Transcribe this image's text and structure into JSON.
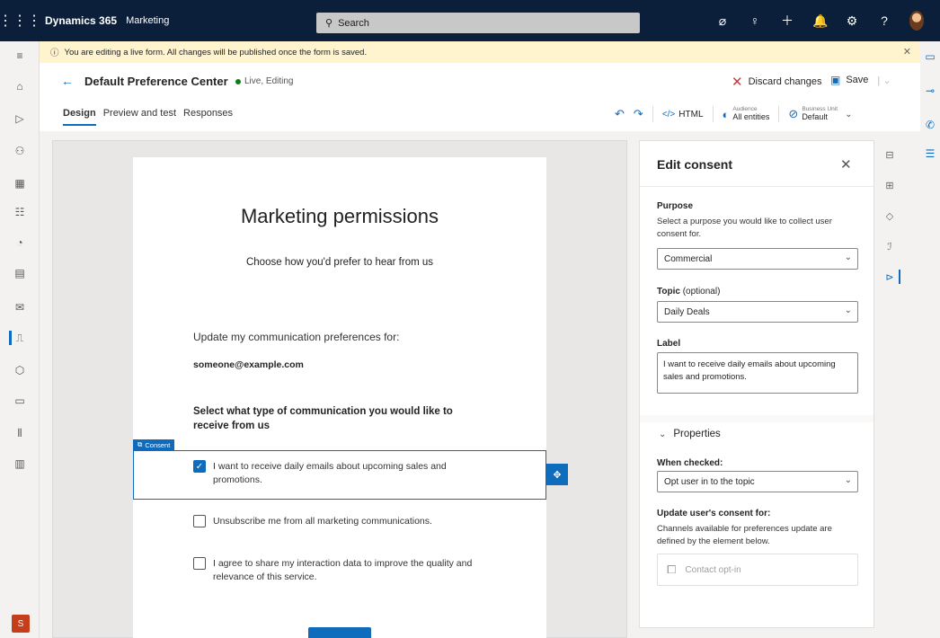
{
  "topbar": {
    "product": "Dynamics 365",
    "module": "Marketing",
    "search_placeholder": "Search"
  },
  "banner": {
    "text": "You are editing a live form. All changes will be published once the form is saved."
  },
  "header": {
    "title": "Default Preference Center",
    "status": "Live, Editing",
    "discard_label": "Discard changes",
    "save_label": "Save",
    "tabs": [
      "Design",
      "Preview and test",
      "Responses"
    ],
    "html_label": "HTML",
    "audience_caption": "Audience",
    "audience_value": "All entities",
    "business_unit_caption": "Business Unit",
    "business_unit_value": "Default"
  },
  "form": {
    "heading": "Marketing permissions",
    "subheading": "Choose how you'd prefer to hear from us",
    "update_text": "Update my communication preferences for:",
    "email": "someone@example.com",
    "select_type": "Select what type of communication you would like to receive from us",
    "consent_tag": "Consent",
    "checkboxes": [
      {
        "label": "I want to receive daily emails about upcoming sales and promotions.",
        "checked": true
      },
      {
        "label": "Unsubscribe me from all marketing communications.",
        "checked": false
      },
      {
        "label": "I agree to share my interaction data to improve the quality and relevance of this service.",
        "checked": false
      }
    ]
  },
  "panel": {
    "title": "Edit consent",
    "purpose_label": "Purpose",
    "purpose_desc": "Select a purpose you would like to collect user consent for.",
    "purpose_value": "Commercial",
    "topic_label": "Topic",
    "topic_optional": "(optional)",
    "topic_value": "Daily Deals",
    "label_label": "Label",
    "label_value": "I want to receive daily emails about upcoming sales and promotions.",
    "properties_label": "Properties",
    "when_checked_label": "When checked:",
    "when_checked_value": "Opt user in to the topic",
    "update_consent_label": "Update user's consent for:",
    "update_consent_desc": "Channels available for preferences update are defined by the element below.",
    "contact_optin": "Contact opt-in"
  },
  "leftnav": {
    "area_initial": "S"
  },
  "colors": {
    "accent": "#0f6cbd",
    "topbar": "#0b1f3a",
    "banner": "#fff4ce",
    "live_status": "#107c10",
    "discard": "#d13438",
    "area_badge": "#c43e1c"
  }
}
